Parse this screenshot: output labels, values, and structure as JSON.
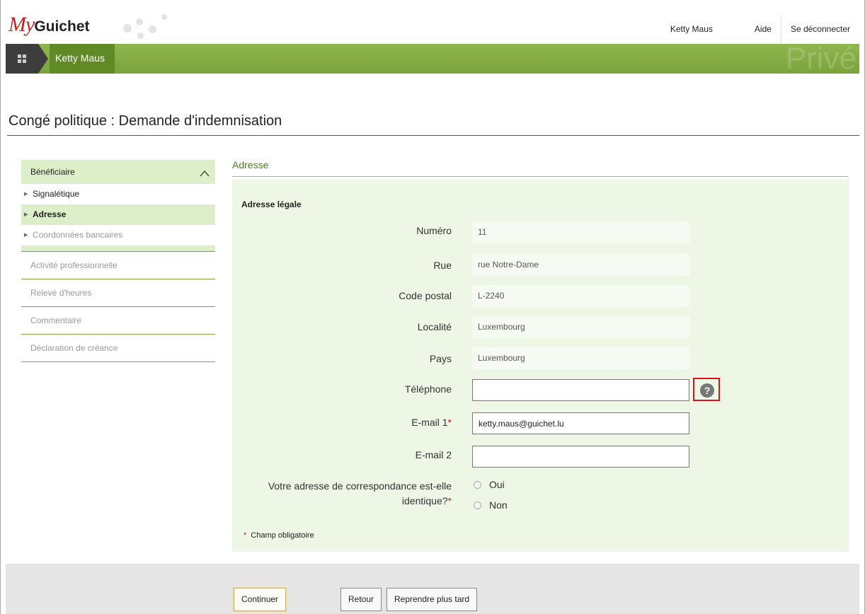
{
  "header": {
    "logo_my": "My",
    "logo_guichet": "Guichet",
    "user_name": "Ketty Maus",
    "help_link": "Aide",
    "logout_link": "Se déconnecter"
  },
  "navbar": {
    "user_label": "Ketty Maus",
    "watermark": "Privé"
  },
  "page": {
    "title": "Congé politique : Demande d'indemnisation"
  },
  "sidebar": {
    "section": "Bénéficiaire",
    "sub_items": [
      {
        "label": "Signalétique",
        "state": "normal"
      },
      {
        "label": "Adresse",
        "state": "active"
      },
      {
        "label": "Coordonnées bancaires",
        "state": "disabled"
      }
    ],
    "items": [
      {
        "label": "Activité professionnelle"
      },
      {
        "label": "Relevé d'heures"
      },
      {
        "label": "Commentaire"
      },
      {
        "label": "Déclaration de créance"
      }
    ]
  },
  "form": {
    "section_title": "Adresse",
    "subsection_title": "Adresse légale",
    "fields": {
      "numero": {
        "label": "Numéro",
        "value": "11"
      },
      "rue": {
        "label": "Rue",
        "value": "rue Notre-Dame"
      },
      "code_postal": {
        "label": "Code postal",
        "value": "L-2240"
      },
      "localite": {
        "label": "Localité",
        "value": "Luxembourg"
      },
      "pays": {
        "label": "Pays",
        "value": "Luxembourg"
      },
      "telephone": {
        "label": "Téléphone",
        "value": ""
      },
      "email1": {
        "label": "E-mail 1",
        "value": "ketty.maus@guichet.lu"
      },
      "email2": {
        "label": "E-mail 2",
        "value": ""
      }
    },
    "required_marker": "*",
    "correspondence_question_line1": "Votre adresse de correspondance est-elle",
    "correspondence_question_line2": "identique?",
    "radio_yes": "Oui",
    "radio_no": "Non",
    "required_note": "Champ obligatoire",
    "help_icon_glyph": "?"
  },
  "footer": {
    "continue": "Continuer",
    "back": "Retour",
    "resume_later": "Reprendre plus tard"
  },
  "colors": {
    "accent_green": "#7aa33a",
    "panel_bg": "#eef6e6",
    "logo_red": "#c0251f",
    "highlight_red": "#e0131b"
  }
}
